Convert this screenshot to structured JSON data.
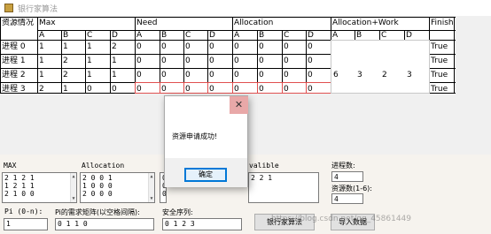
{
  "window": {
    "title": "银行家算法"
  },
  "table": {
    "headers": {
      "resource": "资源情况",
      "max": "Max",
      "need": "Need",
      "allocation": "Allocation",
      "alloc_work": "Allocation+Work",
      "finish": "Finish"
    },
    "sub_headers": [
      "A",
      "B",
      "C",
      "D"
    ],
    "rows": [
      {
        "process": "进程 0",
        "max": [
          "1",
          "1",
          "1",
          "2"
        ],
        "need": [
          "0",
          "0",
          "0",
          "0"
        ],
        "allocation": [
          "0",
          "0",
          "0",
          "0"
        ],
        "finish": "True"
      },
      {
        "process": "进程 1",
        "max": [
          "1",
          "2",
          "1",
          "1"
        ],
        "need": [
          "0",
          "0",
          "0",
          "0"
        ],
        "allocation": [
          "0",
          "0",
          "0",
          "0"
        ],
        "finish": "True"
      },
      {
        "process": "进程 2",
        "max": [
          "1",
          "2",
          "1",
          "1"
        ],
        "need": [
          "0",
          "0",
          "0",
          "0"
        ],
        "allocation": [
          "0",
          "0",
          "0",
          "0"
        ],
        "finish": "True"
      },
      {
        "process": "进程 3",
        "max": [
          "2",
          "1",
          "0",
          "0"
        ],
        "need": [
          "0",
          "0",
          "0",
          "0"
        ],
        "allocation": [
          "0",
          "0",
          "0",
          "0"
        ],
        "finish": "True"
      }
    ],
    "alloc_work_values": [
      "6",
      "3",
      "2",
      "3"
    ]
  },
  "dialog": {
    "message": "资源申请成功!",
    "ok_label": "确定",
    "close_glyph": "✕"
  },
  "bottom": {
    "max_label": "MAX",
    "max_lines": [
      "2 1 2 1",
      "1 2 1 1",
      "2 1 0 0"
    ],
    "allocation_label": "Allocation",
    "allocation_lines": [
      "2 0 0 1",
      "1 0 0 0",
      "2 0 0 0"
    ],
    "need_lines": [
      "0",
      "0",
      "0"
    ],
    "available_label": "valible",
    "available_lines": [
      "2 2 1"
    ],
    "process_count_label": "进程数:",
    "process_count_value": "4",
    "resource_count_label": "资源数(1-6):",
    "resource_count_value": "4",
    "pi_label": "Pi (0-n):",
    "pi_value": "1",
    "request_label": "Pi的需求矩阵(以空格间隔):",
    "request_value": "0 1 1 0",
    "safe_label": "安全序列:",
    "safe_value": "0 1 2 3",
    "banker_button": "银行家算法",
    "import_button": "导入数据"
  },
  "watermark": "https://blog.csdn.net/qq_45861449"
}
